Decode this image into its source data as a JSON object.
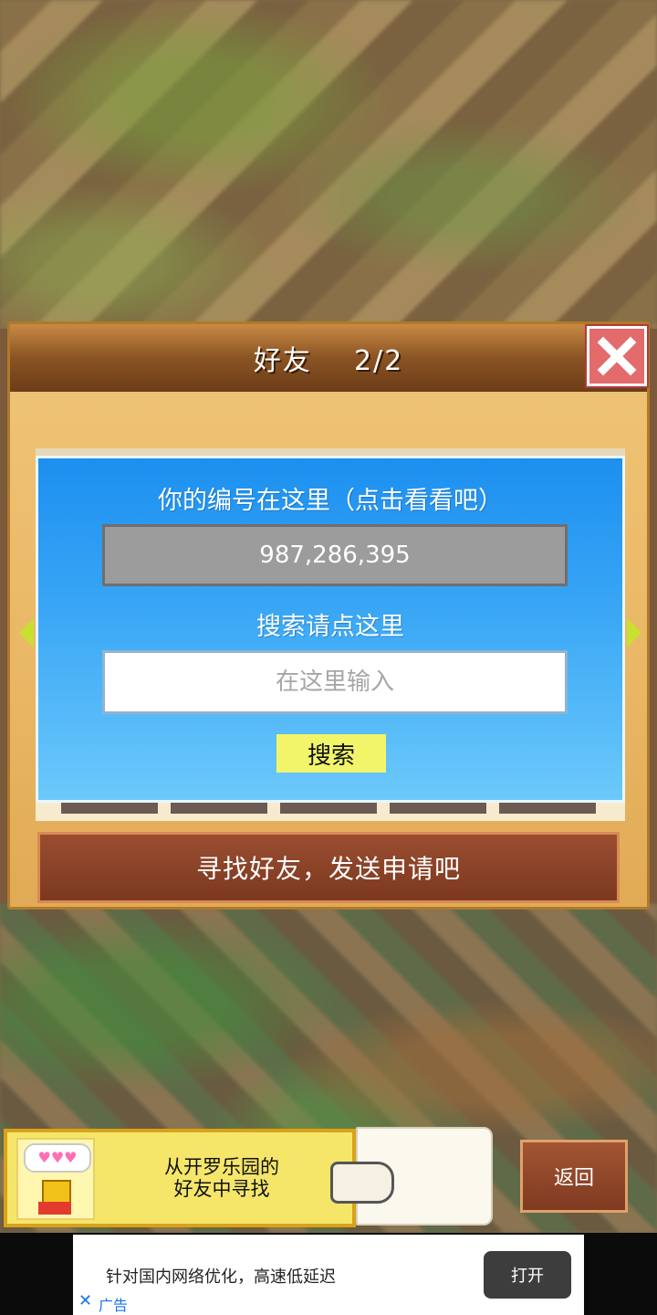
{
  "dialog": {
    "title": "好友",
    "page": "2/2"
  },
  "panel": {
    "id_label": "你的编号在这里（点击看看吧）",
    "id_value": "987,286,395",
    "search_label": "搜索请点这里",
    "search_placeholder": "在这里输入",
    "search_button": "搜索"
  },
  "find_button": "寻找好友，发送申请吧",
  "promo": {
    "line1": "从开罗乐园的",
    "line2": "好友中寻找",
    "bubble": "♥♥♥"
  },
  "back_button": "返回",
  "ad": {
    "text": "针对国内网络优化，高速低延迟",
    "open_button": "打开",
    "close_glyph": "✕",
    "tag": "广告"
  },
  "colors": {
    "panel_top": "#1c8ff0",
    "panel_bottom": "#6cc9fb",
    "search_button": "#f2f56a",
    "close_button": "#e36b6b"
  }
}
